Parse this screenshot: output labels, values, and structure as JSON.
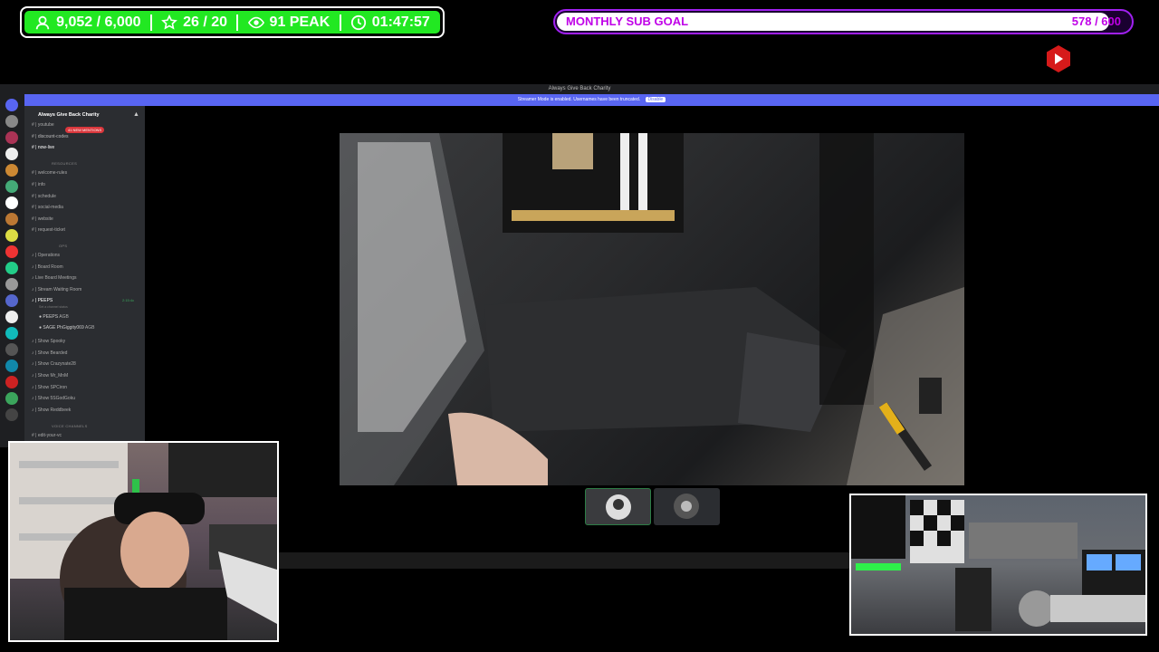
{
  "stats": {
    "followers": "9,052 / 6,000",
    "stars": "26 / 20",
    "peak": "91 PEAK",
    "timer": "01:47:57"
  },
  "goal": {
    "label": "MONTHLY SUB GOAL",
    "count": "578 / 600",
    "progress": 0.963
  },
  "discord": {
    "window_title": "Always Give Back Charity",
    "banner_text": "Streamer Mode is enabled. Usernames have been truncated.",
    "banner_button": "Disable",
    "server_name": "Always Give Back Charity",
    "mentions_badge": "41 NEW MENTIONS",
    "channels_top": [
      "youtube",
      "discount-codes",
      "now-live"
    ],
    "cat_resources": "RESOURCES",
    "channels_resources": [
      "welcome-rules",
      "info",
      "schedule",
      "social-media",
      "website",
      "request-ticket"
    ],
    "cat_ops": "OPS",
    "channels_ops": [
      "Operations",
      "Board Room",
      "Live Board Meetings",
      "Stream Waiting Room",
      "PEEPS"
    ],
    "peeps_time": "2:15:4c",
    "peeps_sub": "Set a channel status",
    "voice_users": [
      "PEEPS",
      "SAGE PhGiggity069"
    ],
    "live_tag": "AGB",
    "channels_shows": [
      "Show Spooky",
      "Show Bearded",
      "Show Crazynate28",
      "Show Mr_MnM",
      "Show SPCiron",
      "Show 5SGodGoku",
      "Show Reddbeek"
    ],
    "cat_voice": "VOICE CHANNELS",
    "channels_voice": [
      "edit-your-vc"
    ]
  },
  "colors": {
    "stats_green": "#22e822",
    "goal_purple": "#a020f0",
    "discord_blurple": "#5865f2"
  }
}
